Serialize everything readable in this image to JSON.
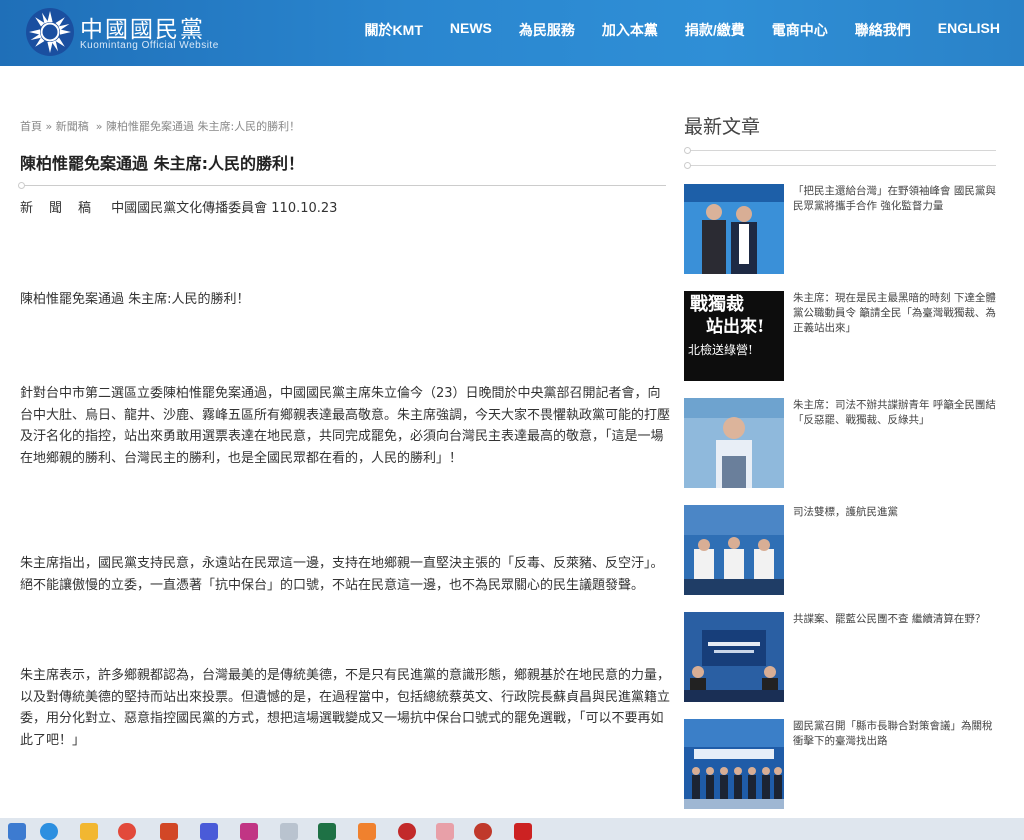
{
  "header": {
    "brand_title": "中國國民黨",
    "brand_subtitle": "Kuomintang Official Website",
    "nav": [
      "關於KMT",
      "NEWS",
      "為民服務",
      "加入本黨",
      "捐款/繳費",
      "電商中心",
      "聯絡我們",
      "ENGLISH"
    ]
  },
  "breadcrumb": {
    "home": "首頁",
    "sep": "»",
    "section": "新聞稿",
    "current": "陳柏惟罷免案通過 朱主席:人民的勝利！"
  },
  "article": {
    "title": "陳柏惟罷免案通過 朱主席:人民的勝利！",
    "byline_label": "新聞稿",
    "byline_text": "中國國民黨文化傳播委員會 110.10.23",
    "paragraphs": [
      "陳柏惟罷免案通過 朱主席:人民的勝利！",
      "針對台中市第二選區立委陳柏惟罷免案通過，中國國民黨主席朱立倫今（23）日晚間於中央黨部召開記者會，向台中大肚、烏日、龍井、沙鹿、霧峰五區所有鄉親表達最高敬意。朱主席強調，今天大家不畏懼執政黨可能的打壓及汙名化的指控，站出來勇敢用選票表達在地民意，共同完成罷免，必須向台灣民主表達最高的敬意，「這是一場在地鄉親的勝利、台灣民主的勝利，也是全國民眾都在看的，人民的勝利」！",
      "朱主席指出，國民黨支持民意，永遠站在民眾這一邊，支持在地鄉親一直堅決主張的「反毒、反萊豬、反空汙」。絕不能讓傲慢的立委，一直憑著「抗中保台」的口號，不站在民意這一邊，也不為民眾關心的民生議題發聲。",
      "朱主席表示，許多鄉親都認為，台灣最美的是傳統美德，不是只有民進黨的意識形態，鄉親基於在地民意的力量，以及對傳統美德的堅持而站出來投票。但遺憾的是，在過程當中，包括總統蔡英文、行政院長蘇貞昌與民進黨籍立委，用分化對立、惡意指控國民黨的方式，想把這場選戰變成又一場抗中保台口號式的罷免選戰，「可以不要再如此了吧！」"
    ]
  },
  "sidebar": {
    "title": "最新文章",
    "posts": [
      {
        "title": "「把民主還給台灣」在野領袖峰會 國民黨與民眾黨將攜手合作 強化監督力量"
      },
      {
        "title": "朱主席：現在是民主最黑暗的時刻 下達全體黨公職動員令 籲請全民「為臺灣戰獨裁、為正義站出來」"
      },
      {
        "title": "朱主席：司法不辦共諜辦青年 呼籲全民團結「反惡罷、戰獨裁、反綠共」"
      },
      {
        "title": "司法雙標，護航民進黨"
      },
      {
        "title": "共諜案、罷藍公民團不查 繼續清算在野？"
      },
      {
        "title": "國民黨召開「縣市長聯合對策會議」為關稅衝擊下的臺灣找出路"
      }
    ]
  },
  "thumb_text": {
    "post2_line1": "戰獨裁",
    "post2_line2": "站出來!",
    "post2_line3": "北檢送綠營!"
  },
  "colors": {
    "header_blue": "#2a86cf",
    "text": "#333333",
    "muted": "#888888"
  }
}
